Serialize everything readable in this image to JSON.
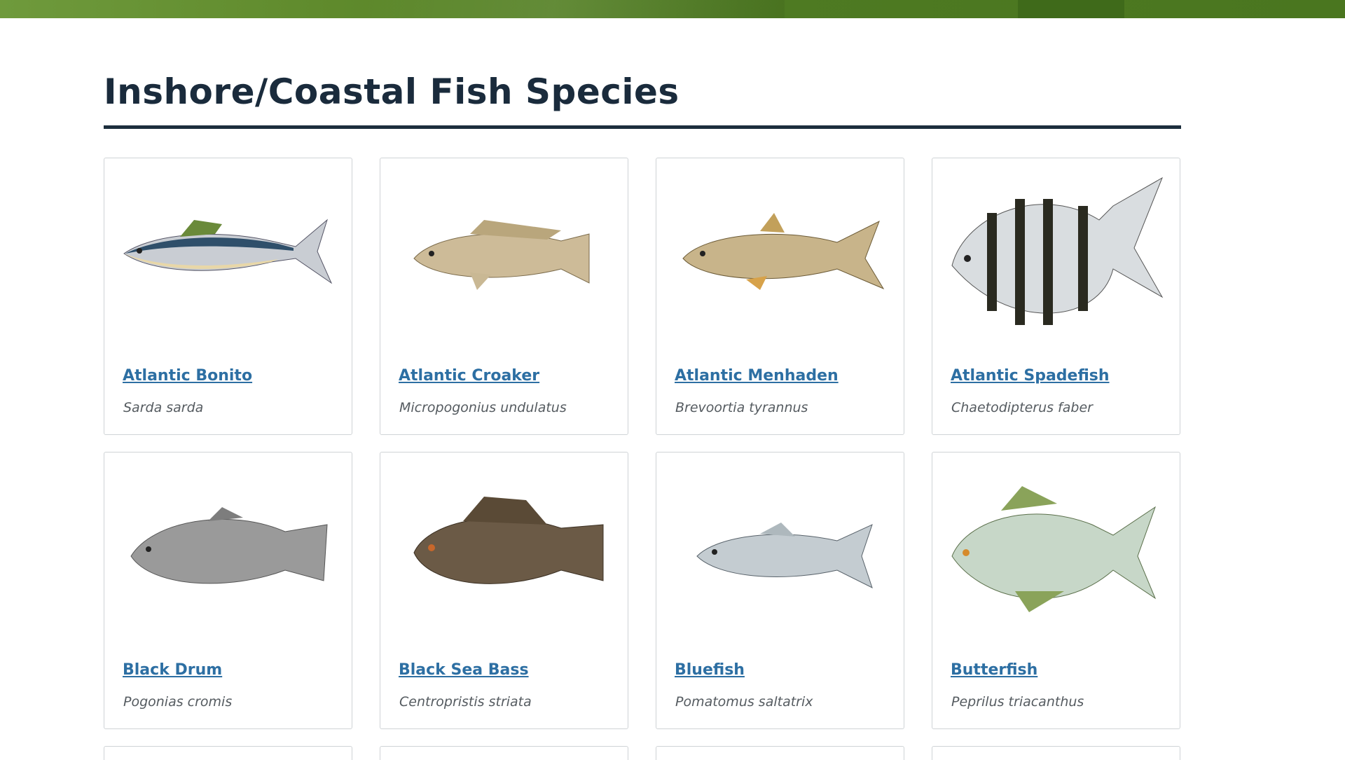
{
  "heading": {
    "title": "Inshore/Coastal Fish Species"
  },
  "species": [
    {
      "name": "Atlantic Bonito",
      "scientific": "Sarda sarda",
      "icon": "bonito-illustration"
    },
    {
      "name": "Atlantic Croaker",
      "scientific": "Micropogonius undulatus",
      "icon": "croaker-illustration"
    },
    {
      "name": "Atlantic Menhaden",
      "scientific": "Brevoortia tyrannus",
      "icon": "menhaden-illustration"
    },
    {
      "name": "Atlantic Spadefish",
      "scientific": "Chaetodipterus faber",
      "icon": "spadefish-illustration"
    },
    {
      "name": "Black Drum",
      "scientific": "Pogonias cromis",
      "icon": "black-drum-illustration"
    },
    {
      "name": "Black Sea Bass",
      "scientific": "Centropristis striata",
      "icon": "black-sea-bass-illustration"
    },
    {
      "name": "Bluefish",
      "scientific": "Pomatomus saltatrix",
      "icon": "bluefish-illustration"
    },
    {
      "name": "Butterfish",
      "scientific": "Peprilus triacanthus",
      "icon": "butterfish-illustration"
    }
  ],
  "colors": {
    "banner": "#5a8529",
    "title": "#1a2b3c",
    "link": "#2d6fa3",
    "scientific": "#555b60",
    "card_border": "#cfd3d6"
  }
}
